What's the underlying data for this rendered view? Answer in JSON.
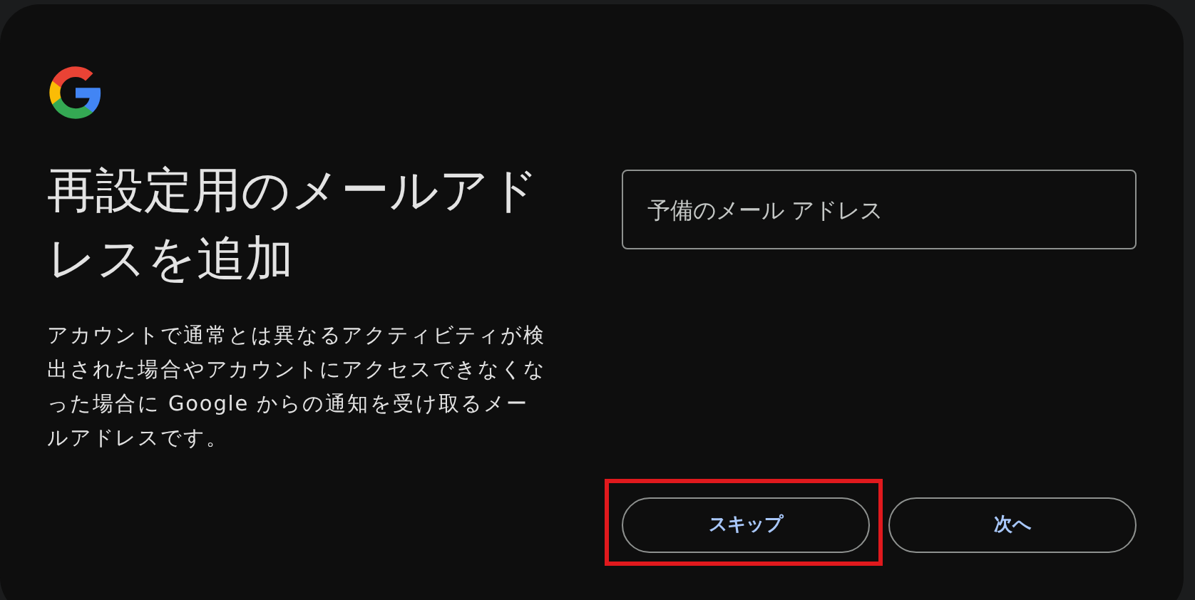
{
  "title": "再設定用のメールアドレスを追加",
  "description": "アカウントで通常とは異なるアクティビティが検出された場合やアカウントにアクセスできなくなった場合に Google からの通知を受け取るメールアドレスです。",
  "email_field": {
    "placeholder": "予備のメール アドレス"
  },
  "buttons": [
    {
      "label": "スキップ",
      "highlighted": true
    },
    {
      "label": "次へ",
      "highlighted": false
    }
  ]
}
